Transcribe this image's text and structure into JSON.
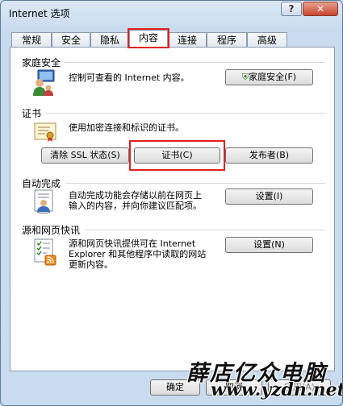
{
  "window": {
    "title": "Internet 选项",
    "help_label": "?",
    "close_label": "✕"
  },
  "tabs": [
    {
      "label": "常规"
    },
    {
      "label": "安全"
    },
    {
      "label": "隐私"
    },
    {
      "label": "内容",
      "active": true
    },
    {
      "label": "连接"
    },
    {
      "label": "程序"
    },
    {
      "label": "高级"
    }
  ],
  "family_safety": {
    "title": "家庭安全",
    "description": "控制可查看的 Internet 内容。",
    "button": "家庭安全(F)"
  },
  "certificates": {
    "title": "证书",
    "description": "使用加密连接和标识的证书。",
    "clear_ssl": "清除 SSL 状态(S)",
    "certificates_button": "证书(C)",
    "publishers_button": "发布者(B)"
  },
  "autocomplete": {
    "title": "自动完成",
    "description_line1": "自动完成功能会存储以前在网页上",
    "description_line2": "输入的内容，并向你建议匹配项。",
    "settings_button": "设置(I)"
  },
  "feeds": {
    "title": "源和网页快讯",
    "description_line1": "源和网页快讯提供可在 Internet",
    "description_line2": "Explorer 和其他程序中读取的网站",
    "description_line3": "更新内容。",
    "settings_button": "设置(N)"
  },
  "footer": {
    "ok": "确定",
    "cancel": "取消",
    "apply": "应用(A)"
  },
  "watermark": {
    "line1": "薛店亿众电脑",
    "line2": "www.yzdn.net"
  }
}
